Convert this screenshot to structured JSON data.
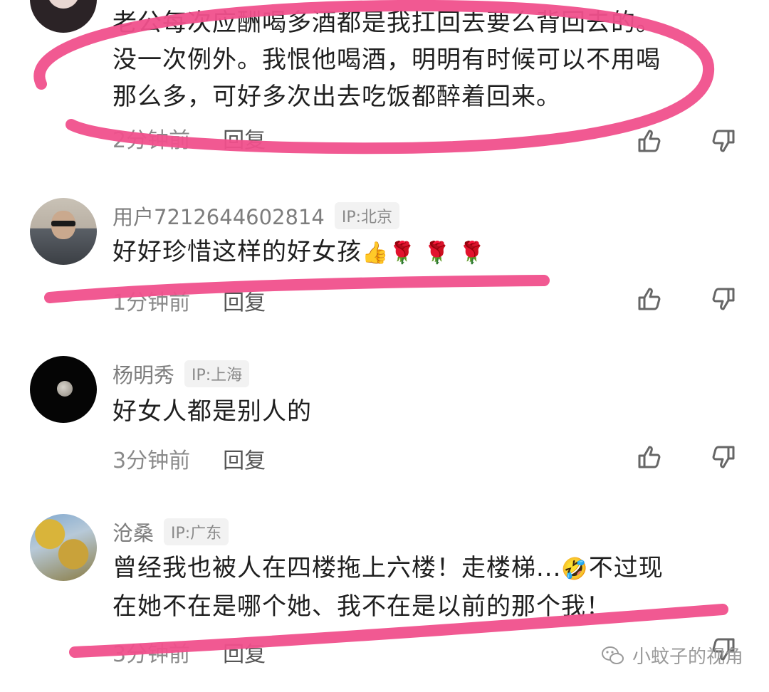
{
  "comments": [
    {
      "username": "",
      "ip": "",
      "lines": [
        "老公每次应酬喝多酒都是我扛回去要么背回去的。",
        "没一次例外。我恨他喝酒，明明有时候可以不用喝",
        "那么多，可好多次出去吃饭都醉着回来。"
      ],
      "time": "2分钟前",
      "reply": "回复"
    },
    {
      "username": "用户7212644602814",
      "ip": "IP:北京",
      "lines": [
        "好好珍惜这样的好女孩"
      ],
      "emojis": "👍🌹 🌹 🌹",
      "time": "1分钟前",
      "reply": "回复"
    },
    {
      "username": "杨明秀",
      "ip": "IP:上海",
      "lines": [
        "好女人都是别人的"
      ],
      "time": "3分钟前",
      "reply": "回复"
    },
    {
      "username": "沧桑",
      "ip": "IP:广东",
      "lines": [
        "曾经我也被人在四楼拖上六楼！走楼梯...",
        "在她不在是哪个她、我不在是以前的那个我！"
      ],
      "line1_tail": "不过现",
      "emoji": "🤣",
      "time": "3分钟前",
      "reply": "回复"
    }
  ],
  "watermark": "小蚊子的视角",
  "icons": [
    "thumbs-up-icon",
    "thumbs-down-icon",
    "wechat-icon"
  ],
  "colors": {
    "highlight": "#f0508c",
    "muted": "#8a8a8a",
    "text": "#1f1f1f"
  }
}
